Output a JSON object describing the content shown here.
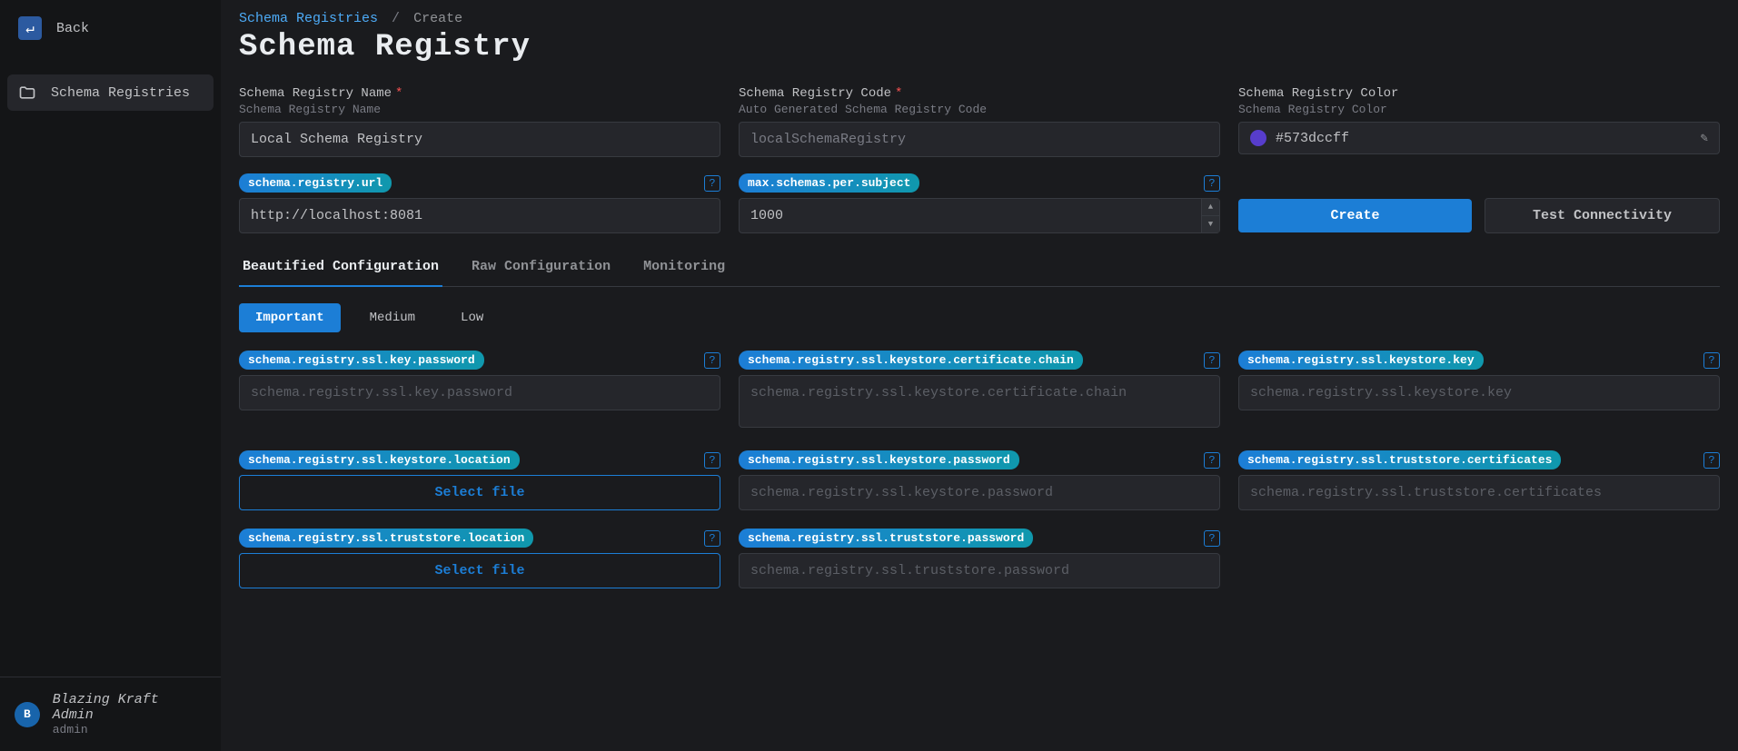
{
  "sidebar": {
    "back": "Back",
    "nav_item": "Schema Registries",
    "user": {
      "initial": "B",
      "name": "Blazing Kraft Admin",
      "sub": "admin"
    }
  },
  "breadcrumb": {
    "link": "Schema Registries",
    "sep": "/",
    "current": "Create"
  },
  "page_title": "Schema Registry",
  "fields": {
    "name": {
      "label": "Schema Registry Name",
      "desc": "Schema Registry Name",
      "value": "Local Schema Registry"
    },
    "code": {
      "label": "Schema Registry Code",
      "desc": "Auto Generated Schema Registry Code",
      "value": "localSchemaRegistry"
    },
    "color": {
      "label": "Schema Registry Color",
      "desc": "Schema Registry Color",
      "value": "#573dccff",
      "swatch": "#573dcc"
    }
  },
  "url_prop": {
    "badge": "schema.registry.url",
    "value": "http://localhost:8081"
  },
  "max_schemas": {
    "badge": "max.schemas.per.subject",
    "value": "1000"
  },
  "actions": {
    "create": "Create",
    "test": "Test Connectivity"
  },
  "tabs": {
    "t1": "Beautified Configuration",
    "t2": "Raw Configuration",
    "t3": "Monitoring"
  },
  "levels": {
    "p1": "Important",
    "p2": "Medium",
    "p3": "Low"
  },
  "select_file": "Select file",
  "config_items": [
    {
      "badge": "schema.registry.ssl.key.password",
      "placeholder": "schema.registry.ssl.key.password",
      "type": "text"
    },
    {
      "badge": "schema.registry.ssl.keystore.certificate.chain",
      "placeholder": "schema.registry.ssl.keystore.certificate.chain",
      "type": "textarea"
    },
    {
      "badge": "schema.registry.ssl.keystore.key",
      "placeholder": "schema.registry.ssl.keystore.key",
      "type": "text"
    },
    {
      "badge": "schema.registry.ssl.keystore.location",
      "type": "file"
    },
    {
      "badge": "schema.registry.ssl.keystore.password",
      "placeholder": "schema.registry.ssl.keystore.password",
      "type": "text"
    },
    {
      "badge": "schema.registry.ssl.truststore.certificates",
      "placeholder": "schema.registry.ssl.truststore.certificates",
      "type": "text"
    },
    {
      "badge": "schema.registry.ssl.truststore.location",
      "type": "file"
    },
    {
      "badge": "schema.registry.ssl.truststore.password",
      "placeholder": "schema.registry.ssl.truststore.password",
      "type": "text"
    }
  ]
}
